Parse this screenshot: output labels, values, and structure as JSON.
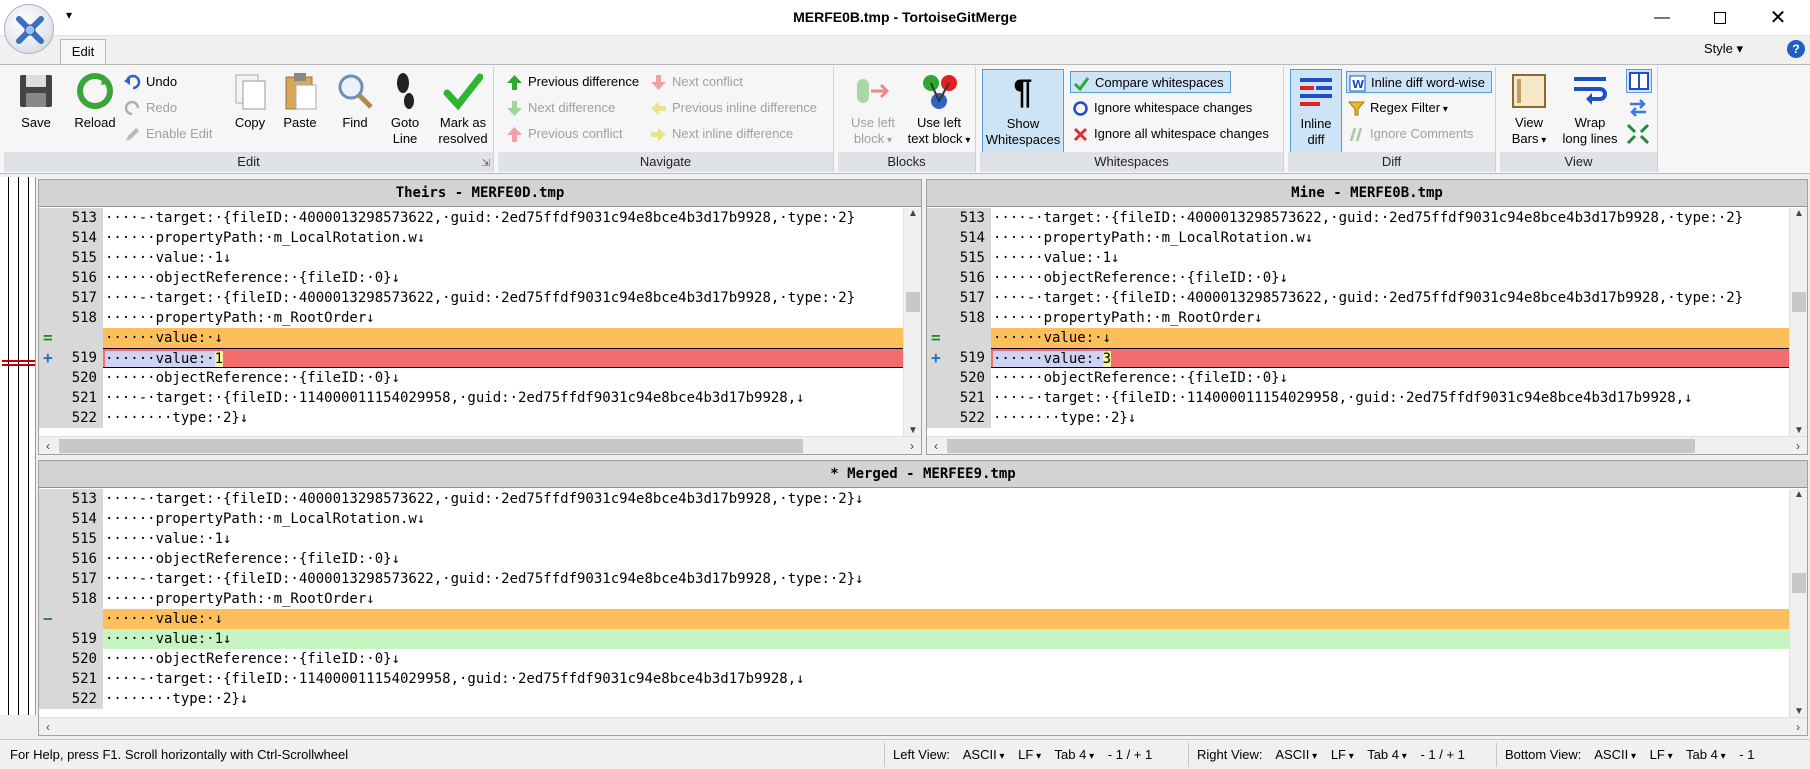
{
  "window": {
    "title": "MERFE0B.tmp - TortoiseGitMerge"
  },
  "tabs": {
    "edit": "Edit",
    "style": "Style",
    "help": "?"
  },
  "ribbon": {
    "edit_group": {
      "label": "Edit",
      "save": "Save",
      "reload": "Reload",
      "undo": "Undo",
      "redo": "Redo",
      "enable_edit": "Enable Edit",
      "copy": "Copy",
      "paste": "Paste",
      "find": "Find",
      "goto_line_1": "Goto",
      "goto_line_2": "Line",
      "mark_resolved_1": "Mark as",
      "mark_resolved_2": "resolved"
    },
    "navigate_group": {
      "label": "Navigate",
      "prev_diff": "Previous difference",
      "next_diff": "Next difference",
      "prev_conflict": "Previous conflict",
      "next_conflict": "Next conflict",
      "prev_inline": "Previous inline difference",
      "next_inline": "Next inline difference"
    },
    "blocks_group": {
      "label": "Blocks",
      "use_left_block_1": "Use left",
      "use_left_block_2": "block",
      "use_left_text_1": "Use left",
      "use_left_text_2": "text block"
    },
    "whitespaces_group": {
      "label": "Whitespaces",
      "show_ws_1": "Show",
      "show_ws_2": "Whitespaces",
      "compare_ws": "Compare whitespaces",
      "ignore_ws_changes": "Ignore whitespace changes",
      "ignore_all_ws": "Ignore all whitespace changes"
    },
    "diff_group": {
      "label": "Diff",
      "inline_diff_1": "Inline",
      "inline_diff_2": "diff",
      "word_wise": "Inline diff word-wise",
      "regex": "Regex Filter",
      "ignore_comments": "Ignore Comments"
    },
    "view_group": {
      "label": "View",
      "view_bars_1": "View",
      "view_bars_2": "Bars",
      "wrap_1": "Wrap",
      "wrap_2": "long lines"
    }
  },
  "panes": {
    "theirs": {
      "title": "Theirs - MERFE0D.tmp",
      "lines": [
        {
          "num": "513",
          "sym": "",
          "kind": "normal",
          "text": "····-·target:·{fileID:·4000013298573622,·guid:·2ed75ffdf9031c94e8bce4b3d17b9928,·type:·2}"
        },
        {
          "num": "514",
          "sym": "",
          "kind": "normal",
          "text": "······propertyPath:·m_LocalRotation.w↓"
        },
        {
          "num": "515",
          "sym": "",
          "kind": "normal",
          "text": "······value:·1↓"
        },
        {
          "num": "516",
          "sym": "",
          "kind": "normal",
          "text": "······objectReference:·{fileID:·0}↓"
        },
        {
          "num": "517",
          "sym": "",
          "kind": "normal",
          "text": "····-·target:·{fileID:·4000013298573622,·guid:·2ed75ffdf9031c94e8bce4b3d17b9928,·type:·2}"
        },
        {
          "num": "518",
          "sym": "",
          "kind": "normal",
          "text": "······propertyPath:·m_RootOrder↓"
        },
        {
          "num": "",
          "sym": "=",
          "kind": "empty",
          "text": "······value:·↓"
        },
        {
          "num": "519",
          "sym": "+",
          "kind": "changed",
          "pre": "······value:·",
          "val": "1",
          "post": ""
        },
        {
          "num": "520",
          "sym": "",
          "kind": "normal",
          "text": "······objectReference:·{fileID:·0}↓"
        },
        {
          "num": "521",
          "sym": "",
          "kind": "normal",
          "text": "····-·target:·{fileID:·114000011154029958,·guid:·2ed75ffdf9031c94e8bce4b3d17b9928,↓"
        },
        {
          "num": "522",
          "sym": "",
          "kind": "normal",
          "text": "········type:·2}↓"
        }
      ]
    },
    "mine": {
      "title": "Mine - MERFE0B.tmp",
      "lines": [
        {
          "num": "513",
          "sym": "",
          "kind": "normal",
          "text": "····-·target:·{fileID:·4000013298573622,·guid:·2ed75ffdf9031c94e8bce4b3d17b9928,·type:·2}"
        },
        {
          "num": "514",
          "sym": "",
          "kind": "normal",
          "text": "······propertyPath:·m_LocalRotation.w↓"
        },
        {
          "num": "515",
          "sym": "",
          "kind": "normal",
          "text": "······value:·1↓"
        },
        {
          "num": "516",
          "sym": "",
          "kind": "normal",
          "text": "······objectReference:·{fileID:·0}↓"
        },
        {
          "num": "517",
          "sym": "",
          "kind": "normal",
          "text": "····-·target:·{fileID:·4000013298573622,·guid:·2ed75ffdf9031c94e8bce4b3d17b9928,·type:·2}"
        },
        {
          "num": "518",
          "sym": "",
          "kind": "normal",
          "text": "······propertyPath:·m_RootOrder↓"
        },
        {
          "num": "",
          "sym": "=",
          "kind": "empty",
          "text": "······value:·↓"
        },
        {
          "num": "519",
          "sym": "+",
          "kind": "changed",
          "pre": "······value:·",
          "val": "3",
          "post": ""
        },
        {
          "num": "520",
          "sym": "",
          "kind": "normal",
          "text": "······objectReference:·{fileID:·0}↓"
        },
        {
          "num": "521",
          "sym": "",
          "kind": "normal",
          "text": "····-·target:·{fileID:·114000011154029958,·guid:·2ed75ffdf9031c94e8bce4b3d17b9928,↓"
        },
        {
          "num": "522",
          "sym": "",
          "kind": "normal",
          "text": "········type:·2}↓"
        }
      ]
    },
    "merged": {
      "title": "* Merged - MERFEE9.tmp",
      "lines": [
        {
          "num": "513",
          "sym": "",
          "kind": "normal",
          "text": "····-·target:·{fileID:·4000013298573622,·guid:·2ed75ffdf9031c94e8bce4b3d17b9928,·type:·2}↓"
        },
        {
          "num": "514",
          "sym": "",
          "kind": "normal",
          "text": "······propertyPath:·m_LocalRotation.w↓"
        },
        {
          "num": "515",
          "sym": "",
          "kind": "normal",
          "text": "······value:·1↓"
        },
        {
          "num": "516",
          "sym": "",
          "kind": "normal",
          "text": "······objectReference:·{fileID:·0}↓"
        },
        {
          "num": "517",
          "sym": "",
          "kind": "normal",
          "text": "····-·target:·{fileID:·4000013298573622,·guid:·2ed75ffdf9031c94e8bce4b3d17b9928,·type:·2}↓"
        },
        {
          "num": "518",
          "sym": "",
          "kind": "normal",
          "text": "······propertyPath:·m_RootOrder↓"
        },
        {
          "num": "",
          "sym": "−",
          "kind": "empty",
          "text": "······value:·↓"
        },
        {
          "num": "519",
          "sym": "",
          "kind": "added",
          "text": "······value:·1↓"
        },
        {
          "num": "520",
          "sym": "",
          "kind": "normal",
          "text": "······objectReference:·{fileID:·0}↓"
        },
        {
          "num": "521",
          "sym": "",
          "kind": "normal",
          "text": "····-·target:·{fileID:·114000011154029958,·guid:·2ed75ffdf9031c94e8bce4b3d17b9928,↓"
        },
        {
          "num": "522",
          "sym": "",
          "kind": "normal",
          "text": "········type:·2}↓"
        }
      ]
    }
  },
  "status": {
    "help": "For Help, press F1. Scroll horizontally with Ctrl-Scrollwheel",
    "left_view": {
      "label": "Left View:",
      "encoding": "ASCII",
      "eol": "LF",
      "tab": "Tab 4",
      "count": "- 1 / + 1"
    },
    "right_view": {
      "label": "Right View:",
      "encoding": "ASCII",
      "eol": "LF",
      "tab": "Tab 4",
      "count": "- 1 / + 1"
    },
    "bottom_view": {
      "label": "Bottom View:",
      "encoding": "ASCII",
      "eol": "LF",
      "tab": "Tab 4",
      "count": "- 1"
    }
  },
  "colors": {
    "empty_line": "#ffbe5c",
    "changed_line": "#f26d6d",
    "added_line": "#c7f5c1",
    "gutter": "#d8d8d8",
    "header": "#d3d3d3",
    "ribbon_active": "#cde4f7"
  }
}
